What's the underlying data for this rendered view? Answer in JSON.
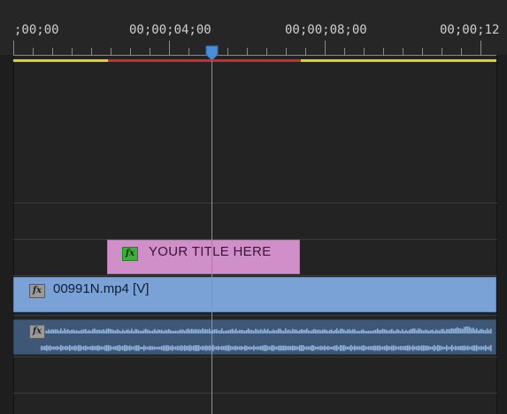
{
  "ruler": {
    "timecodes": [
      ";00;00",
      "00;00;04;00",
      "00;00;08;00",
      "00;00;12"
    ]
  },
  "tracks": {
    "title_clip": {
      "label": "YOUR TITLE HERE",
      "fx_icon": "fx-badge-icon"
    },
    "video_clip": {
      "label": "00991N.mp4 [V]",
      "fx_icon": "fx-badge-icon"
    },
    "audio_clip": {
      "fx_icon": "fx-badge-icon"
    }
  },
  "fx_text": "fx",
  "colors": {
    "background": "#232323",
    "title_clip": "#d08fc8",
    "video_clip": "#7ba2d6",
    "audio_clip": "#3f5777",
    "playhead": "#4aa3e8",
    "work_area_yellow": "#e0d21a",
    "work_area_red": "#d22a2a"
  }
}
